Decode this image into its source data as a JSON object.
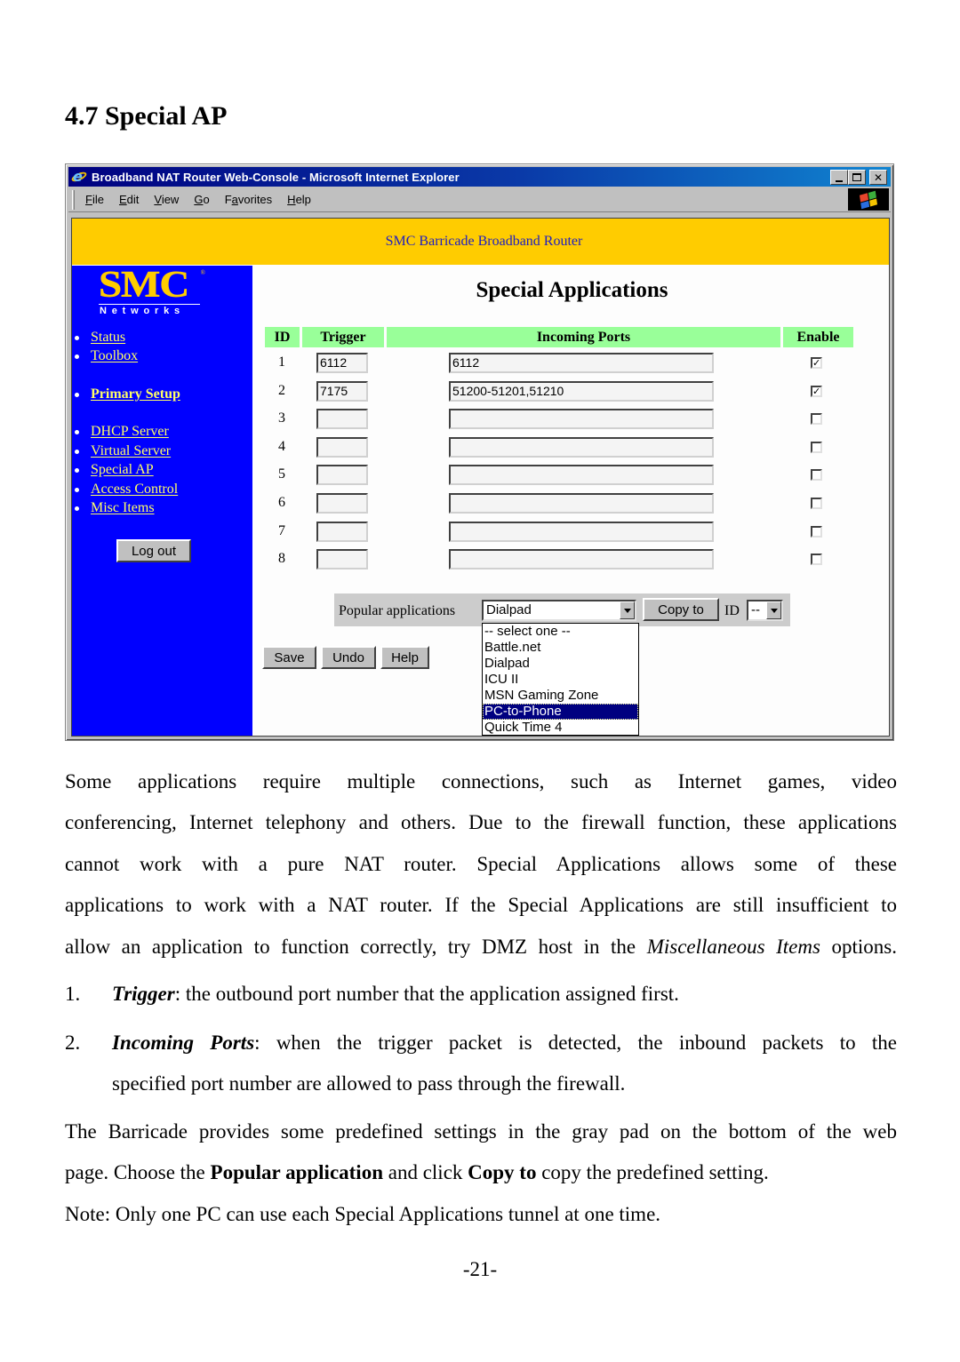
{
  "section_title": "4.7 Special AP",
  "window": {
    "title": "Broadband NAT Router Web-Console - Microsoft Internet Explorer",
    "title_buttons": [
      "minimize",
      "maximize",
      "close"
    ],
    "menu": [
      {
        "label": "File",
        "accel": "F",
        "rest": "ile"
      },
      {
        "label": "Edit",
        "accel": "E",
        "rest": "dit"
      },
      {
        "label": "View",
        "accel": "V",
        "rest": "iew"
      },
      {
        "label": "Go",
        "accel": "G",
        "rest": "o"
      },
      {
        "label": "Favorites",
        "pre": "F",
        "accel": "a",
        "rest": "vorites"
      },
      {
        "label": "Help",
        "accel": "H",
        "rest": "elp"
      }
    ]
  },
  "router": {
    "banner": "SMC Barricade Broadband Router",
    "colors": {
      "banner": "#ffcc00",
      "sidebar": "#0000ff",
      "header": "#99ff99",
      "link": "#ffff66"
    },
    "logo": {
      "brand": "SMC",
      "sub": "Networks",
      "reg": "®"
    },
    "nav": [
      {
        "label": "Status",
        "bold": false
      },
      {
        "label": "Toolbox",
        "bold": false
      },
      {
        "label": "Primary Setup",
        "bold": true
      },
      {
        "label": "DHCP Server",
        "bold": false
      },
      {
        "label": "Virtual Server",
        "bold": false
      },
      {
        "label": "Special AP",
        "bold": false
      },
      {
        "label": "Access Control",
        "bold": false
      },
      {
        "label": "Misc Items",
        "bold": false
      }
    ],
    "logout_label": "Log out",
    "page_title": "Special Applications",
    "table": {
      "headers": {
        "id": "ID",
        "trigger": "Trigger",
        "incoming": "Incoming Ports",
        "enable": "Enable"
      },
      "rows": [
        {
          "id": "1",
          "trigger": "6112",
          "incoming": "6112",
          "enabled": true
        },
        {
          "id": "2",
          "trigger": "7175",
          "incoming": "51200-51201,51210",
          "enabled": true
        },
        {
          "id": "3",
          "trigger": "",
          "incoming": "",
          "enabled": false
        },
        {
          "id": "4",
          "trigger": "",
          "incoming": "",
          "enabled": false
        },
        {
          "id": "5",
          "trigger": "",
          "incoming": "",
          "enabled": false
        },
        {
          "id": "6",
          "trigger": "",
          "incoming": "",
          "enabled": false
        },
        {
          "id": "7",
          "trigger": "",
          "incoming": "",
          "enabled": false
        },
        {
          "id": "8",
          "trigger": "",
          "incoming": "",
          "enabled": false
        }
      ]
    },
    "popular": {
      "label": "Popular applications",
      "selected": "Dialpad",
      "options": [
        "-- select one --",
        "Battle.net",
        "Dialpad",
        "ICU II",
        "MSN Gaming Zone",
        "PC-to-Phone",
        "Quick Time 4"
      ],
      "highlighted": "PC-to-Phone",
      "copy_label": "Copy to",
      "id_label": "ID",
      "id_selected": "--"
    },
    "buttons": {
      "save": "Save",
      "undo": "Undo",
      "help": "Help"
    }
  },
  "body": {
    "para1_lines": [
      "Some applications require multiple connections, such as Internet games, video",
      "conferencing, Internet telephony and others. Due to the firewall function, these applications",
      "cannot work with a pure NAT router. Special Applications allows some of these",
      "applications to work with a NAT router. If the Special Applications are still insufficient to"
    ],
    "para1_last_pre": "allow an application to function correctly, try DMZ host in the ",
    "para1_last_em": "Miscellaneous Items",
    "para1_last_post": " options.",
    "list": [
      {
        "num": "1.",
        "term": "Trigger",
        "text": ": the outbound port number that the application assigned first."
      },
      {
        "num": "2.",
        "term": "Incoming Ports",
        "text_line1": ": when the trigger packet is detected, the inbound packets to the",
        "text_line2": "specified port number are allowed to pass through the firewall."
      }
    ],
    "para2_line1": "The Barricade provides some predefined settings in the gray pad on the bottom of the web",
    "para2_line2_pre": "page. Choose the ",
    "para2_line2_b1": "Popular application",
    "para2_line2_mid": " and click ",
    "para2_line2_b2": "Copy to",
    "para2_line2_post": " copy the predefined setting.",
    "note": "Note: Only one PC can use each Special Applications tunnel at one time."
  },
  "page_number": "-21-"
}
